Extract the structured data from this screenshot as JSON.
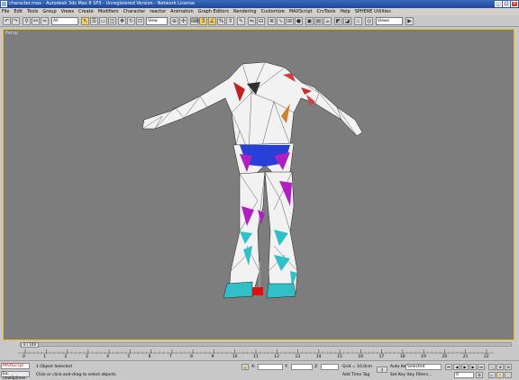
{
  "window": {
    "title": "character.max - Autodesk 3ds Max 8 SP3 - Unregistered Version - Network License",
    "controls": [
      "_",
      "□",
      "×"
    ]
  },
  "menu": [
    "File",
    "Edit",
    "Tools",
    "Group",
    "Views",
    "Create",
    "Modifiers",
    "Character",
    "reactor",
    "Animation",
    "Graph Editors",
    "Rendering",
    "Customize",
    "MAXScript",
    "CrvTools",
    "Help",
    "SPHERE Utilities"
  ],
  "toolbar": {
    "undo_icon": "undo-icon",
    "selection_filter": "All",
    "coord_system": "View",
    "named_selection": "Views"
  },
  "viewport": {
    "label": "Persp",
    "background": "#7d7d7d",
    "active_border": "#e8c020"
  },
  "timeline": {
    "frame_indicator": "0 / 100",
    "ticks": [
      "0",
      "1",
      "2",
      "3",
      "4",
      "5",
      "6",
      "7",
      "8",
      "9",
      "10",
      "11",
      "12",
      "13",
      "14",
      "15",
      "16",
      "17",
      "18",
      "19",
      "20",
      "21",
      "22"
    ]
  },
  "status": {
    "maxscript_logo": "MAXScript",
    "mini_listener": "Ex. newSplines ▸",
    "selection_text": "1 Object Selected",
    "prompt_text": "Click or click-and-drag to select objects",
    "x_label": "X:",
    "y_label": "Y:",
    "z_label": "Z:",
    "grid_text": "Grid = 10.0cm",
    "add_time_tag": "Add Time Tag",
    "auto_key": "Auto Key",
    "auto_key_mode": "Selected",
    "set_key": "Set Key",
    "key_filters": "Key Filters...",
    "current_frame": "0"
  }
}
